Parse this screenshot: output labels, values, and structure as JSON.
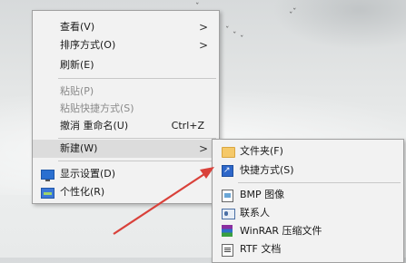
{
  "main_menu": {
    "items": [
      {
        "label": "查看(V)",
        "has_submenu": true
      },
      {
        "label": "排序方式(O)",
        "has_submenu": true
      },
      {
        "label": "刷新(E)"
      },
      {
        "label": "粘贴(P)",
        "disabled": true
      },
      {
        "label": "粘贴快捷方式(S)",
        "disabled": true
      },
      {
        "label": "撤消 重命名(U)",
        "shortcut": "Ctrl+Z"
      },
      {
        "label": "新建(W)",
        "has_submenu": true,
        "highlighted": true
      },
      {
        "label": "显示设置(D)",
        "icon": "display-icon"
      },
      {
        "label": "个性化(R)",
        "icon": "personalize-icon"
      }
    ],
    "submenu_arrow": ">"
  },
  "new_submenu": {
    "items": [
      {
        "label": "文件夹(F)",
        "icon": "folder-icon"
      },
      {
        "label": "快捷方式(S)",
        "icon": "shortcut-icon"
      },
      {
        "label": "BMP 图像",
        "icon": "bmp-image-icon"
      },
      {
        "label": "联系人",
        "icon": "contact-icon"
      },
      {
        "label": "WinRAR 压缩文件",
        "icon": "winrar-archive-icon"
      },
      {
        "label": "RTF 文档",
        "icon": "rtf-document-icon"
      }
    ]
  },
  "annotation": {
    "color": "#d9413a",
    "icon": "red-pointer-arrow"
  }
}
